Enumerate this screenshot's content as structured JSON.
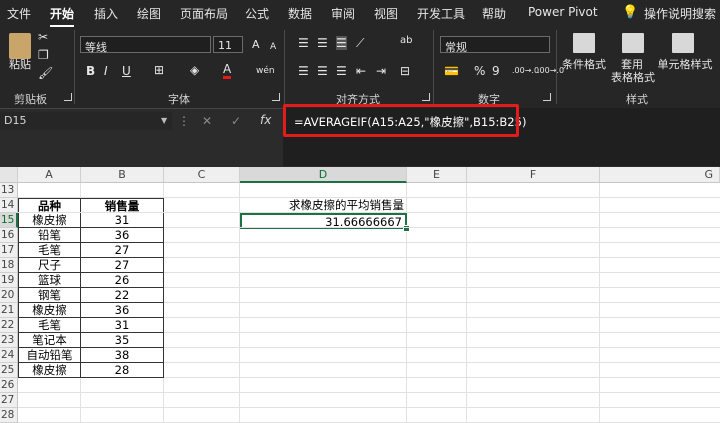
{
  "tabs": [
    "文件",
    "开始",
    "插入",
    "绘图",
    "页面布局",
    "公式",
    "数据",
    "审阅",
    "视图",
    "开发工具",
    "帮助",
    "Power Pivot"
  ],
  "search_label": "操作说明搜索",
  "clipboard": {
    "paste": "粘贴",
    "group": "剪贴板"
  },
  "font": {
    "name": "等线",
    "size": "11",
    "group": "字体",
    "bold": "B",
    "italic": "I",
    "underline": "U",
    "grow": "A",
    "shrink": "A",
    "font_color": "A",
    "phonetic": "wén"
  },
  "alignment": {
    "group": "对齐方式",
    "wrap": "ab",
    "orient": "ab"
  },
  "number": {
    "format": "常规",
    "group": "数字",
    "percent": "%",
    "comma": "9",
    "inc": ".00→.0",
    "dec": ".00→.0"
  },
  "styles": {
    "cond": "条件格式",
    "table1": "套用",
    "table2": "表格格式",
    "cell": "单元格样式",
    "group": "样式"
  },
  "formula_bar": {
    "name_box": "D15",
    "cancel": "✕",
    "enter": "✓",
    "fx": "fx",
    "formula": "=AVERAGEIF(A15:A25,\"橡皮擦\",B15:B25)"
  },
  "columns": [
    "A",
    "B",
    "C",
    "D",
    "E",
    "F",
    "G"
  ],
  "rows": [
    "13",
    "14",
    "15",
    "16",
    "17",
    "18",
    "19",
    "20",
    "21",
    "22",
    "23",
    "24",
    "25",
    "26",
    "27",
    "28"
  ],
  "table": {
    "headers": [
      "品种",
      "销售量"
    ],
    "items": [
      [
        "橡皮擦",
        "31"
      ],
      [
        "铅笔",
        "36"
      ],
      [
        "毛笔",
        "27"
      ],
      [
        "尺子",
        "27"
      ],
      [
        "篮球",
        "26"
      ],
      [
        "钢笔",
        "22"
      ],
      [
        "橡皮擦",
        "36"
      ],
      [
        "毛笔",
        "31"
      ],
      [
        "笔记本",
        "35"
      ],
      [
        "自动铅笔",
        "38"
      ],
      [
        "橡皮擦",
        "28"
      ]
    ]
  },
  "result": {
    "label": "求橡皮擦的平均销售量",
    "value": "31.66666667"
  },
  "colors": {
    "ribbon_bg": "#262626",
    "highlight": "#e31b1b",
    "select": "#1e7145"
  }
}
